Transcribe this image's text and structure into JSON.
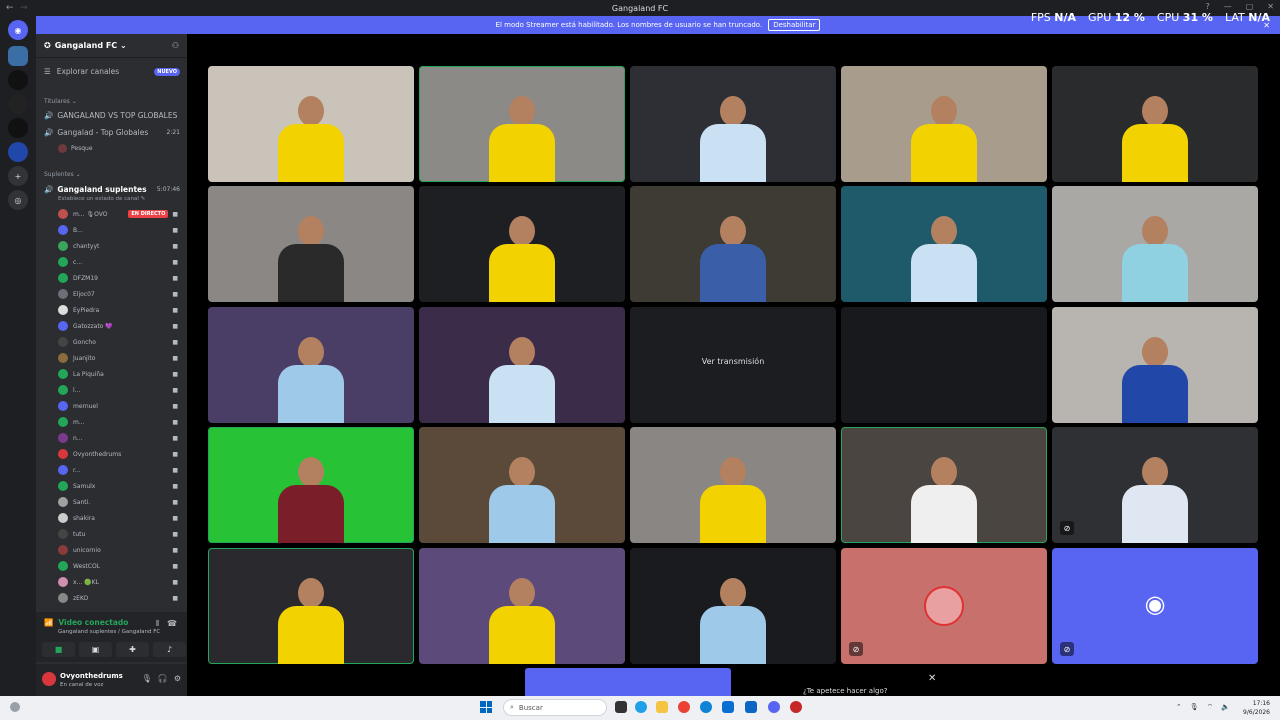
{
  "window": {
    "title": "Gangaland FC",
    "back_glyph": "←",
    "forward_glyph": "→",
    "controls": [
      "?",
      "—",
      "▢",
      "✕"
    ]
  },
  "stats": {
    "fps_label": "FPS",
    "fps_value": "N/A",
    "gpu_label": "GPU",
    "gpu_value": "12 %",
    "cpu_label": "CPU",
    "cpu_value": "31 %",
    "lat_label": "LAT",
    "lat_value": "N/A"
  },
  "banner": {
    "text": "El modo Streamer está habilitado. Los nombres de usuario se han truncado.",
    "button": "Deshabilitar",
    "close": "✕"
  },
  "server": {
    "name": "Gangaland FC",
    "explore": "Explorar canales",
    "explore_badge": "NUEVO"
  },
  "categories": {
    "titulares": "Titulares",
    "suplentes": "Suplentes"
  },
  "channels": {
    "c1": "GANGALAND VS TOP GLOBALES",
    "c2": "Gangalad - Top Globales",
    "c2_time": "2:21",
    "c2_member": "Pesque",
    "c3": "Gangaland suplentes",
    "c3_time": "5:07:46",
    "c3_sub": "Establece un estado de canal"
  },
  "members": [
    {
      "name": "m... 🎙OVO",
      "color": "#c0504d",
      "live": "EN DIRECTO"
    },
    {
      "name": "B...",
      "color": "#5865f2"
    },
    {
      "name": "chantyyt",
      "color": "#3ba55d"
    },
    {
      "name": "c...",
      "color": "#23a55a"
    },
    {
      "name": "DFZM19",
      "color": "#23a55a"
    },
    {
      "name": "Eljoc07",
      "color": "#6d6f78"
    },
    {
      "name": "EyPiedra",
      "color": "#ddd"
    },
    {
      "name": "Gatozzato 💜",
      "color": "#5865f2"
    },
    {
      "name": "Goncho",
      "color": "#444"
    },
    {
      "name": "Juanjito",
      "color": "#8a6d3b"
    },
    {
      "name": "La Piquiña",
      "color": "#23a55a"
    },
    {
      "name": "l...",
      "color": "#23a55a"
    },
    {
      "name": "mernuel",
      "color": "#5865f2"
    },
    {
      "name": "m...",
      "color": "#23a55a"
    },
    {
      "name": "n...",
      "color": "#7a3b8f"
    },
    {
      "name": "Ovyonthedrums",
      "color": "#da373c"
    },
    {
      "name": "r...",
      "color": "#5865f2"
    },
    {
      "name": "Samulx",
      "color": "#23a55a"
    },
    {
      "name": "Santi.",
      "color": "#a0a0a0"
    },
    {
      "name": "shakira",
      "color": "#ccc"
    },
    {
      "name": "tutu",
      "color": "#444"
    },
    {
      "name": "unicornio",
      "color": "#8a3b3b"
    },
    {
      "name": "WestCOL",
      "color": "#23a55a"
    },
    {
      "name": "x... 🟢KL",
      "color": "#d08fb0"
    },
    {
      "name": "zEKO",
      "color": "#888"
    }
  ],
  "voice": {
    "status": "Video conectado",
    "location": "Gangaland suplentes / Gangaland FC"
  },
  "user": {
    "name": "Ovyonthedrums",
    "status": "En canal de voz"
  },
  "tiles": [
    {
      "bg": "#c9c3b9",
      "shirt": "#f2d200",
      "speaking": false
    },
    {
      "bg": "#8c8a86",
      "shirt": "#f2d200",
      "speaking": true
    },
    {
      "bg": "#2d2f34",
      "shirt": "#c9e1f2",
      "speaking": false
    },
    {
      "bg": "#a89c8c",
      "shirt": "#f2d200",
      "speaking": false
    },
    {
      "bg": "#2a2b2d",
      "shirt": "#f2d200",
      "speaking": false
    },
    {
      "bg": "#8a8784",
      "shirt": "#2a2a2a",
      "speaking": false
    },
    {
      "bg": "#1e1f22",
      "shirt": "#f2d200",
      "speaking": false
    },
    {
      "bg": "#3e3a34",
      "shirt": "#3a5fa8",
      "speaking": false
    },
    {
      "bg": "#1f5a6a",
      "shirt": "#c9e1f2",
      "speaking": false
    },
    {
      "bg": "#a9a8a4",
      "shirt": "#8fd1e0",
      "speaking": false
    },
    {
      "bg": "#4a3d66",
      "shirt": "#9fc9e8",
      "speaking": false
    },
    {
      "bg": "#3b2c4a",
      "shirt": "#c9e1f2",
      "speaking": false
    },
    {
      "bg": "#1c1d20",
      "label": "Ver transmisión",
      "empty": true
    },
    {
      "bg": "#18191c",
      "empty": true
    },
    {
      "bg": "#b8b5b0",
      "shirt": "#2148a8",
      "speaking": false
    },
    {
      "bg": "#27c235",
      "shirt": "#7a1f2a",
      "speaking": true
    },
    {
      "bg": "#5b4a3a",
      "shirt": "#9fc9e8",
      "speaking": false
    },
    {
      "bg": "#8a8684",
      "shirt": "#f2d200",
      "speaking": false
    },
    {
      "bg": "#4a4540",
      "shirt": "#efefef",
      "speaking": true
    },
    {
      "bg": "#2f3034",
      "shirt": "#dfe8f2",
      "speaking": false,
      "muted": true
    },
    {
      "bg": "#2a2a2e",
      "shirt": "#f2d200",
      "speaking": true
    },
    {
      "bg": "#5b4a7a",
      "shirt": "#f2d200",
      "speaking": false
    },
    {
      "bg": "#1a1b1e",
      "shirt": "#9fc9e8",
      "speaking": false
    },
    {
      "bg": "#c7706c",
      "avatar": true,
      "muted": true
    },
    {
      "bg": "#5865f2",
      "discord": true,
      "muted": true
    }
  ],
  "bottom": {
    "prompt": "¿Te apetece hacer algo?",
    "close": "✕"
  },
  "taskbar": {
    "search": "Buscar",
    "time": "17:16",
    "date": "9/6/2026"
  }
}
